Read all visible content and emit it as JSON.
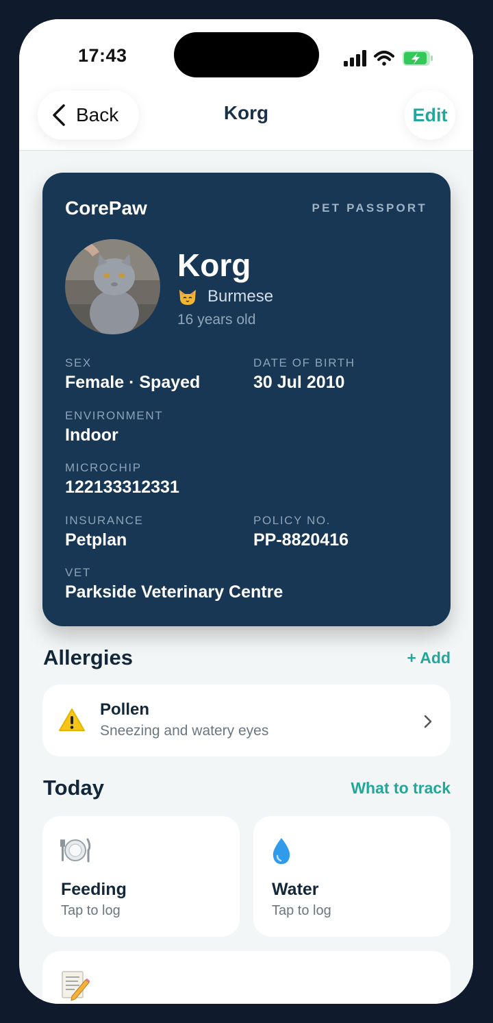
{
  "status_bar": {
    "time": "17:43"
  },
  "nav": {
    "back_label": "Back",
    "title": "Korg",
    "edit_label": "Edit"
  },
  "passport": {
    "brand": "CorePaw",
    "label": "PET PASSPORT",
    "pet_name": "Korg",
    "breed": "Burmese",
    "age": "16 years old",
    "fields": {
      "sex": {
        "label": "SEX",
        "value": "Female · Spayed"
      },
      "dob": {
        "label": "DATE OF BIRTH",
        "value": "30 Jul 2010"
      },
      "environment": {
        "label": "ENVIRONMENT",
        "value": "Indoor"
      },
      "microchip": {
        "label": "MICROCHIP",
        "value": "122133312331"
      },
      "insurance": {
        "label": "INSURANCE",
        "value": "Petplan"
      },
      "policy": {
        "label": "POLICY NO.",
        "value": "PP-8820416"
      },
      "vet": {
        "label": "VET",
        "value": "Parkside Veterinary Centre"
      }
    }
  },
  "allergies": {
    "title": "Allergies",
    "add_label": "+ Add",
    "items": [
      {
        "name": "Pollen",
        "reaction": "Sneezing and watery eyes"
      }
    ]
  },
  "today": {
    "title": "Today",
    "link_label": "What to track",
    "tiles": [
      {
        "icon": "plate-cutlery-icon",
        "label": "Feeding",
        "sub": "Tap to log"
      },
      {
        "icon": "water-drop-icon",
        "label": "Water",
        "sub": "Tap to log"
      },
      {
        "icon": "notepad-pencil-icon"
      }
    ]
  },
  "colors": {
    "accent": "#22a89a",
    "passport_bg": "#173755",
    "page_bg": "#f3f6f6",
    "battery": "#34c759"
  }
}
